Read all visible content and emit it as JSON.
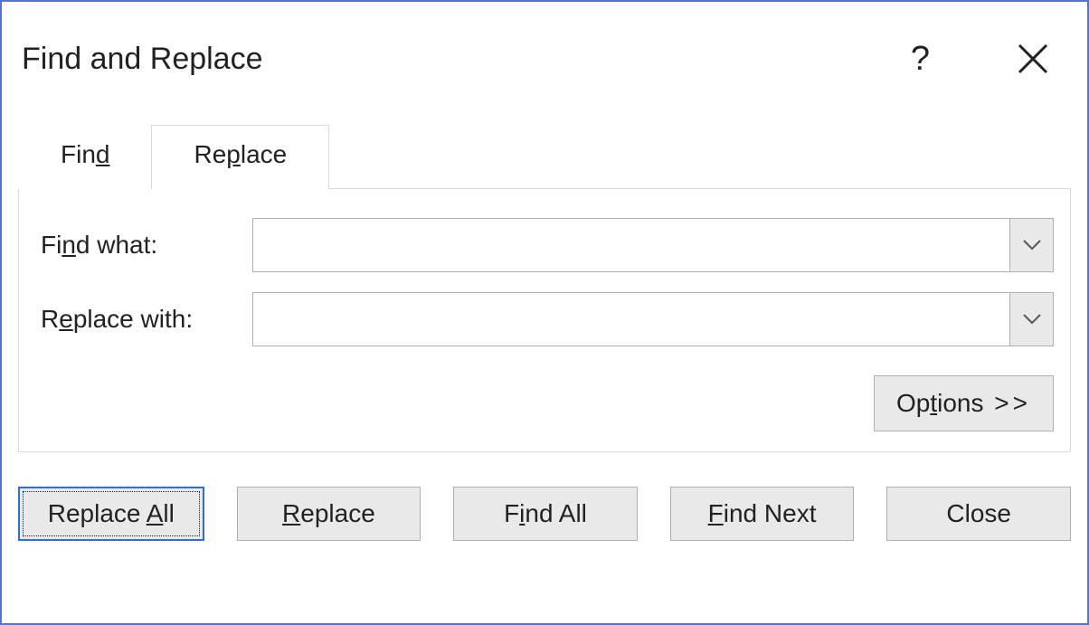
{
  "title": "Find and Replace",
  "tabs": {
    "find": {
      "pre": "Fin",
      "mn": "d",
      "post": ""
    },
    "replace": {
      "pre": "Re",
      "mn": "p",
      "post": "lace"
    }
  },
  "fields": {
    "find_what": {
      "pre": "Fi",
      "mn": "n",
      "post": "d what:",
      "value": ""
    },
    "replace_with": {
      "pre": "R",
      "mn": "e",
      "post": "place with:",
      "value": ""
    }
  },
  "options_button": {
    "pre": "Op",
    "mn": "t",
    "post": "ions ",
    "chevrons": ">>"
  },
  "buttons": {
    "replace_all": {
      "pre": "Replace ",
      "mn": "A",
      "post": "ll"
    },
    "replace": {
      "pre": "",
      "mn": "R",
      "post": "eplace"
    },
    "find_all": {
      "pre": "F",
      "mn": "i",
      "post": "nd All"
    },
    "find_next": {
      "pre": "",
      "mn": "F",
      "post": "ind Next"
    },
    "close": {
      "pre": "Close",
      "mn": "",
      "post": ""
    }
  }
}
